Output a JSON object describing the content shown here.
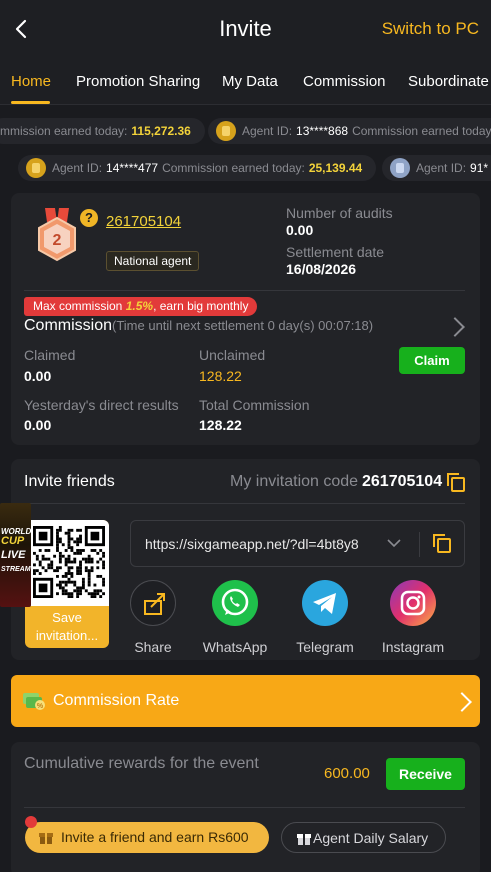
{
  "header": {
    "title": "Invite",
    "switch_label": "Switch to PC"
  },
  "tabs": [
    "Home",
    "Promotion Sharing",
    "My Data",
    "Commission",
    "Subordinate"
  ],
  "ticker_row1": [
    {
      "prefix": "mmission earned today:",
      "amount": "115,272.36"
    },
    {
      "agent_label": "Agent ID:",
      "agent_id": "13****868",
      "suffix": "Commission earned today:"
    }
  ],
  "ticker_row2": [
    {
      "agent_label": "Agent ID:",
      "agent_id": "14****477",
      "earned_label": "Commission earned today:",
      "amount": "25,139.44"
    },
    {
      "agent_label": "Agent ID:",
      "agent_id": "91*"
    }
  ],
  "agent": {
    "level": "2",
    "help": "?",
    "id": "261705104",
    "badge": "National agent",
    "audits_label": "Number of audits",
    "audits_value": "0.00",
    "settlement_label": "Settlement date",
    "settlement_value": "16/08/2026"
  },
  "commission": {
    "promo_prefix": "Max commission",
    "promo_pct": "1.5%",
    "promo_suffix": ", earn big monthly",
    "title": "Commission",
    "subtitle": "(Time until next settlement",
    "countdown": "0 day(s) 00:07:18)",
    "claimed_label": "Claimed",
    "claimed_value": "0.00",
    "unclaimed_label": "Unclaimed",
    "unclaimed_value": "128.22",
    "claim_button": "Claim",
    "yesterday_label": "Yesterday's direct results",
    "yesterday_value": "0.00",
    "total_label": "Total Commission",
    "total_value": "128.22"
  },
  "invite": {
    "title": "Invite friends",
    "code_label": "My invitation code",
    "code": "261705104",
    "save_label": "Save invitation...",
    "link": "https://sixgameapp.net/?dl=4bt8y8",
    "thumb_lines": [
      "WORLD",
      "CUP",
      "LIVE",
      "STREAM"
    ],
    "share_items": [
      {
        "label": "Share",
        "icon": "share-icon"
      },
      {
        "label": "WhatsApp",
        "icon": "whatsapp-icon"
      },
      {
        "label": "Telegram",
        "icon": "telegram-icon"
      },
      {
        "label": "Instagram",
        "icon": "instagram-icon"
      }
    ]
  },
  "rate": {
    "label": "Commission Rate"
  },
  "rewards": {
    "text": "Cumulative rewards for the event",
    "value": "600.00",
    "receive_button": "Receive",
    "invite_pill": "Invite a friend and earn Rs600",
    "salary_pill": "Agent Daily Salary"
  },
  "colors": {
    "accent": "#f8b820",
    "green": "#17b01c",
    "red": "#e23a3a",
    "bg": "#1a1b1f",
    "card": "#222327"
  }
}
